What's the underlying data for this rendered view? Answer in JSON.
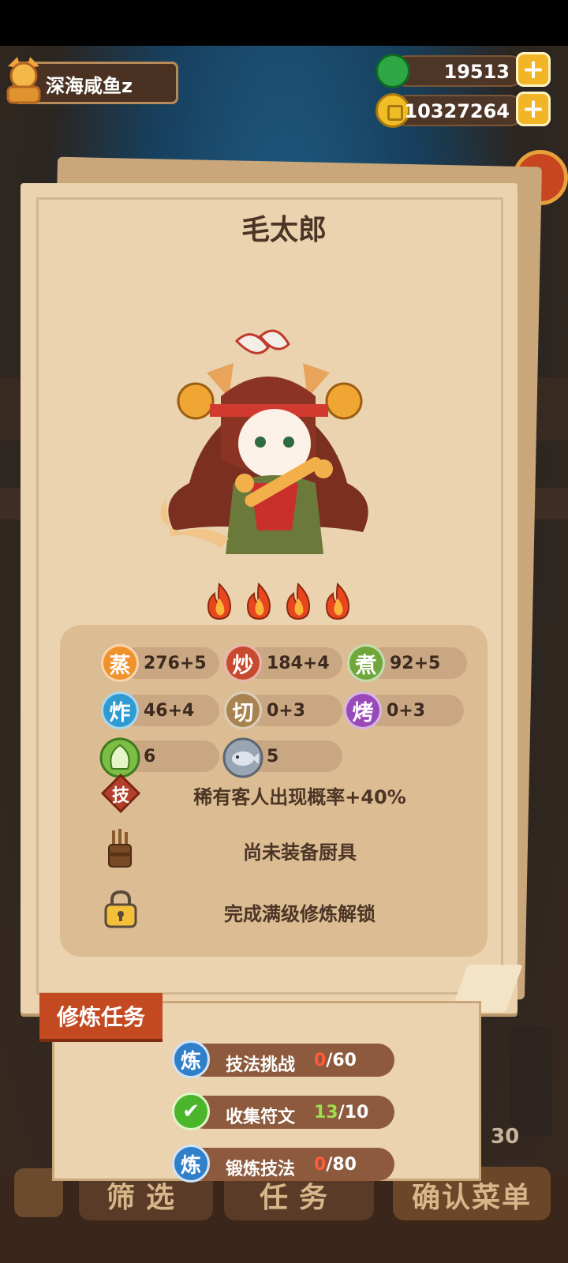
{
  "player": {
    "name": "深海咸鱼z"
  },
  "currencies": [
    {
      "value": "19513",
      "icon": "jade-coin-icon"
    },
    {
      "value": "10327264",
      "icon": "gold-coin-icon"
    }
  ],
  "chef": {
    "name": "毛太郎",
    "rarity_flames": 4,
    "stats": [
      {
        "label": "蒸",
        "value": "276+5",
        "color": "#f0922b"
      },
      {
        "label": "炒",
        "value": "184+4",
        "color": "#c84a2e"
      },
      {
        "label": "煮",
        "value": "92+5",
        "color": "#6fa73a"
      },
      {
        "label": "炸",
        "value": "46+4",
        "color": "#2f9bd2"
      },
      {
        "label": "切",
        "value": "0+3",
        "color": "#a8834f"
      },
      {
        "label": "烤",
        "value": "0+3",
        "color": "#9a49b9"
      }
    ],
    "ingredients": [
      {
        "icon": "vegetable-icon",
        "value": "6"
      },
      {
        "icon": "fish-icon",
        "value": "5"
      }
    ],
    "skill": {
      "badge": "技",
      "text": "稀有客人出现概率+40%"
    },
    "equipment_text": "尚未装备厨具",
    "locked_text": "完成满级修炼解锁"
  },
  "training": {
    "title": "修炼任务",
    "tasks": [
      {
        "badge": "炼",
        "label": "技法挑战",
        "done": "0",
        "total": "/60",
        "state": "incomplete"
      },
      {
        "badge": "",
        "label": "收集符文",
        "done": "13",
        "total": "/10",
        "state": "complete"
      },
      {
        "badge": "炼",
        "label": "锻炼技法",
        "done": "0",
        "total": "/80",
        "state": "incomplete"
      }
    ]
  },
  "bottom_nav": {
    "filter": "筛选",
    "tasks": "任务",
    "confirm": "确认菜单",
    "count": "30"
  }
}
